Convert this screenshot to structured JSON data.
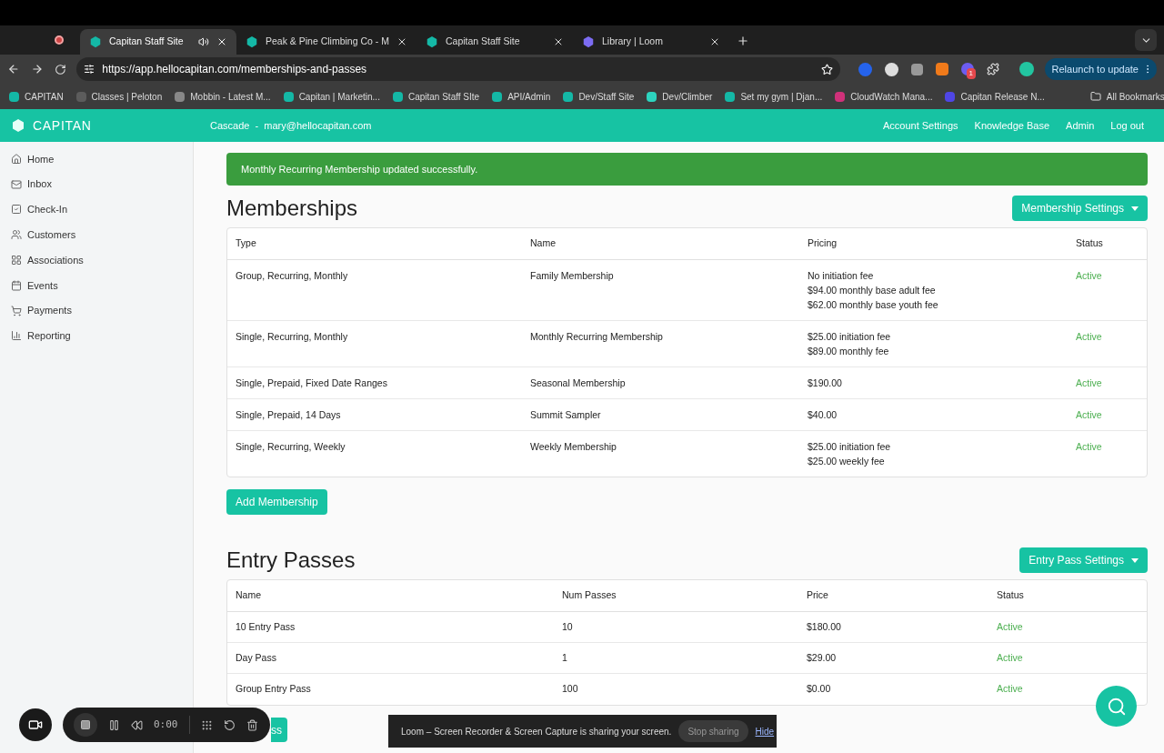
{
  "browser": {
    "tabs": [
      {
        "title": "Capitan Staff Site",
        "selected": true,
        "audio": true
      },
      {
        "title": "Peak & Pine Climbing Co - M",
        "selected": false,
        "audio": false
      },
      {
        "title": "Capitan Staff Site",
        "selected": false,
        "audio": false
      },
      {
        "title": "Library | Loom",
        "selected": false,
        "audio": false
      }
    ],
    "url": "https://app.hellocapitan.com/memberships-and-passes",
    "extension_badge": "1",
    "relaunch": "Relaunch to update",
    "bookmarks": [
      {
        "label": "CAPITAN",
        "color": "#14b8a6"
      },
      {
        "label": "Classes | Peloton",
        "color": "#5c5c5c"
      },
      {
        "label": "Mobbin - Latest M...",
        "color": "#888888"
      },
      {
        "label": "Capitan | Marketin...",
        "color": "#14b8a6"
      },
      {
        "label": "Capitan Staff SIte",
        "color": "#14b8a6"
      },
      {
        "label": "API/Admin",
        "color": "#14b8a6"
      },
      {
        "label": "Dev/Staff Site",
        "color": "#14b8a6"
      },
      {
        "label": "Dev/Climber",
        "color": "#2dd4bf"
      },
      {
        "label": "Set my gym | Djan...",
        "color": "#14b8a6"
      },
      {
        "label": "CloudWatch Mana...",
        "color": "#d0317a"
      },
      {
        "label": "Capitan Release N...",
        "color": "#4f46e5"
      }
    ],
    "all_bookmarks": "All Bookmarks"
  },
  "header": {
    "brand": "CAPITAN",
    "context": "Cascade  -  mary@hellocapitan.com",
    "links": [
      "Account Settings",
      "Knowledge Base",
      "Admin",
      "Log out"
    ]
  },
  "sidebar": {
    "items": [
      {
        "label": "Home"
      },
      {
        "label": "Inbox"
      },
      {
        "label": "Check-In"
      },
      {
        "label": "Customers"
      },
      {
        "label": "Associations"
      },
      {
        "label": "Events"
      },
      {
        "label": "Payments"
      },
      {
        "label": "Reporting"
      }
    ]
  },
  "alert": "Monthly Recurring Membership updated successfully.",
  "memberships": {
    "title": "Memberships",
    "settings_button": "Membership Settings",
    "columns": [
      "Type",
      "Name",
      "Pricing",
      "Status"
    ],
    "rows": [
      {
        "type": "Group, Recurring, Monthly",
        "name": "Family Membership",
        "pricing": [
          "No initiation fee",
          "$94.00 monthly base adult fee",
          "$62.00 monthly base youth fee"
        ],
        "status": "Active"
      },
      {
        "type": "Single, Recurring, Monthly",
        "name": "Monthly Recurring Membership",
        "pricing": [
          "$25.00 initiation fee",
          "$89.00 monthly fee"
        ],
        "status": "Active"
      },
      {
        "type": "Single, Prepaid, Fixed Date Ranges",
        "name": "Seasonal Membership",
        "pricing": [
          "$190.00"
        ],
        "status": "Active"
      },
      {
        "type": "Single, Prepaid, 14 Days",
        "name": "Summit Sampler",
        "pricing": [
          "$40.00"
        ],
        "status": "Active"
      },
      {
        "type": "Single, Recurring, Weekly",
        "name": "Weekly Membership",
        "pricing": [
          "$25.00 initiation fee",
          "$25.00 weekly fee"
        ],
        "status": "Active"
      }
    ],
    "add_button": "Add Membership"
  },
  "entry_passes": {
    "title": "Entry Passes",
    "settings_button": "Entry Pass Settings",
    "columns": [
      "Name",
      "Num Passes",
      "Price",
      "Status"
    ],
    "rows": [
      {
        "name": "10 Entry Pass",
        "num": "10",
        "price": "$180.00",
        "status": "Active"
      },
      {
        "name": "Day Pass",
        "num": "1",
        "price": "$29.00",
        "status": "Active"
      },
      {
        "name": "Group Entry Pass",
        "num": "100",
        "price": "$0.00",
        "status": "Active"
      }
    ],
    "add_button": "ss"
  },
  "recorder": {
    "time": "0:00"
  },
  "share_banner": {
    "message": "Loom – Screen Recorder & Screen Capture is sharing your screen.",
    "stop": "Stop sharing",
    "hide": "Hide"
  }
}
